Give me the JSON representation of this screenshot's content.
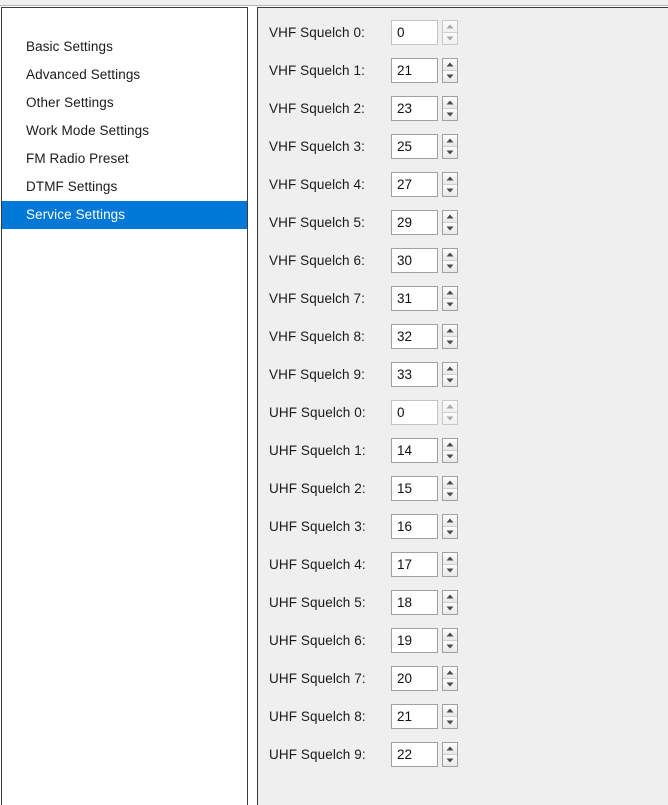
{
  "window": {
    "accent_color": "#0078d7",
    "panel_background": "#efefef",
    "sidebar_background": "#ffffff",
    "border_color": "#3b3b3b"
  },
  "sidebar": {
    "items": [
      {
        "label": "Basic Settings",
        "selected": false
      },
      {
        "label": "Advanced Settings",
        "selected": false
      },
      {
        "label": "Other Settings",
        "selected": false
      },
      {
        "label": "Work Mode Settings",
        "selected": false
      },
      {
        "label": "FM Radio Preset",
        "selected": false
      },
      {
        "label": "DTMF Settings",
        "selected": false
      },
      {
        "label": "Service Settings",
        "selected": true
      }
    ]
  },
  "settings_panel": {
    "spinner": {
      "up_icon": "spinner-up-arrow-icon",
      "down_icon": "spinner-down-arrow-icon"
    },
    "fields": [
      {
        "label": "VHF Squelch 0:",
        "value": "0",
        "dim": true
      },
      {
        "label": "VHF Squelch 1:",
        "value": "21",
        "dim": false
      },
      {
        "label": "VHF Squelch 2:",
        "value": "23",
        "dim": false
      },
      {
        "label": "VHF Squelch 3:",
        "value": "25",
        "dim": false
      },
      {
        "label": "VHF Squelch 4:",
        "value": "27",
        "dim": false
      },
      {
        "label": "VHF Squelch 5:",
        "value": "29",
        "dim": false
      },
      {
        "label": "VHF Squelch 6:",
        "value": "30",
        "dim": false
      },
      {
        "label": "VHF Squelch 7:",
        "value": "31",
        "dim": false
      },
      {
        "label": "VHF Squelch 8:",
        "value": "32",
        "dim": false
      },
      {
        "label": "VHF Squelch 9:",
        "value": "33",
        "dim": false
      },
      {
        "label": "UHF Squelch 0:",
        "value": "0",
        "dim": true
      },
      {
        "label": "UHF Squelch 1:",
        "value": "14",
        "dim": false
      },
      {
        "label": "UHF Squelch 2:",
        "value": "15",
        "dim": false
      },
      {
        "label": "UHF Squelch 3:",
        "value": "16",
        "dim": false
      },
      {
        "label": "UHF Squelch 4:",
        "value": "17",
        "dim": false
      },
      {
        "label": "UHF Squelch 5:",
        "value": "18",
        "dim": false
      },
      {
        "label": "UHF Squelch 6:",
        "value": "19",
        "dim": false
      },
      {
        "label": "UHF Squelch 7:",
        "value": "20",
        "dim": false
      },
      {
        "label": "UHF Squelch 8:",
        "value": "21",
        "dim": false
      },
      {
        "label": "UHF Squelch 9:",
        "value": "22",
        "dim": false
      }
    ]
  }
}
